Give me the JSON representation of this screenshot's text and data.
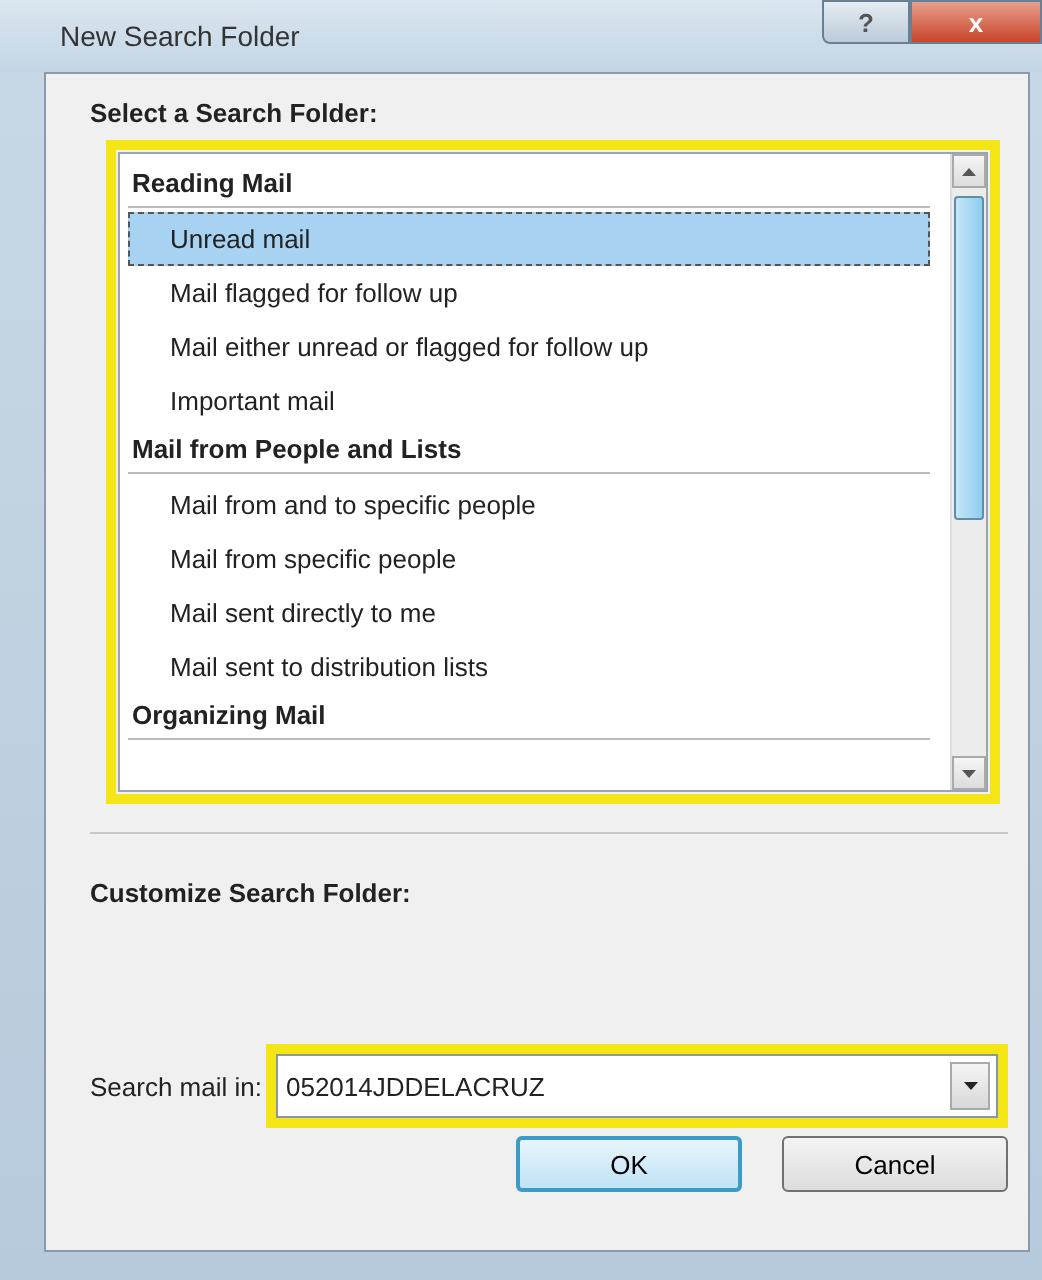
{
  "window": {
    "title": "New Search Folder",
    "help_button": "?",
    "close_button": "x"
  },
  "select_heading": "Select a Search Folder:",
  "folder_list": [
    {
      "kind": "group",
      "label": "Reading Mail"
    },
    {
      "kind": "item",
      "label": "Unread mail",
      "selected": true
    },
    {
      "kind": "item",
      "label": "Mail flagged for follow up",
      "selected": false
    },
    {
      "kind": "item",
      "label": "Mail either unread or flagged for follow up",
      "selected": false
    },
    {
      "kind": "item",
      "label": "Important mail",
      "selected": false
    },
    {
      "kind": "group",
      "label": "Mail from People and Lists"
    },
    {
      "kind": "item",
      "label": "Mail from and to specific people",
      "selected": false
    },
    {
      "kind": "item",
      "label": "Mail from specific people",
      "selected": false
    },
    {
      "kind": "item",
      "label": "Mail sent directly to me",
      "selected": false
    },
    {
      "kind": "item",
      "label": "Mail sent to distribution lists",
      "selected": false
    },
    {
      "kind": "group",
      "label": "Organizing Mail"
    }
  ],
  "customize_heading": "Customize Search Folder:",
  "search_mail_in": {
    "label": "Search mail in:",
    "value": "052014JDDELACRUZ"
  },
  "buttons": [
    {
      "label": "OK",
      "default": true
    },
    {
      "label": "Cancel",
      "default": false
    }
  ]
}
